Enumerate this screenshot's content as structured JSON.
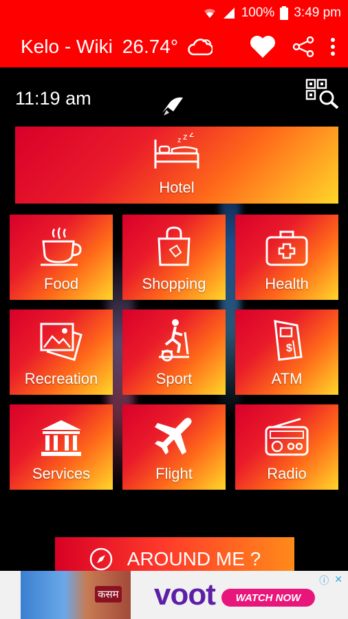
{
  "status_bar": {
    "battery": "100%",
    "time": "3:49 pm"
  },
  "app_bar": {
    "title": "Kelo - Wiki",
    "temperature": "26.74°"
  },
  "header": {
    "clock": "11:19 am"
  },
  "tiles": {
    "hotel": "Hotel",
    "food": "Food",
    "shopping": "Shopping",
    "health": "Health",
    "recreation": "Recreation",
    "sport": "Sport",
    "atm": "ATM",
    "services": "Services",
    "flight": "Flight",
    "radio": "Radio"
  },
  "around_me": {
    "label": "AROUND ME ?"
  },
  "ad": {
    "brand": "voot",
    "cta": "WATCH NOW",
    "show": "कसम"
  },
  "colors": {
    "primary": "#ff0000",
    "tile_start": "#d8002a",
    "tile_end": "#ffd62a",
    "ad_brand": "#5d1fa8",
    "ad_cta": "#e8167b"
  }
}
